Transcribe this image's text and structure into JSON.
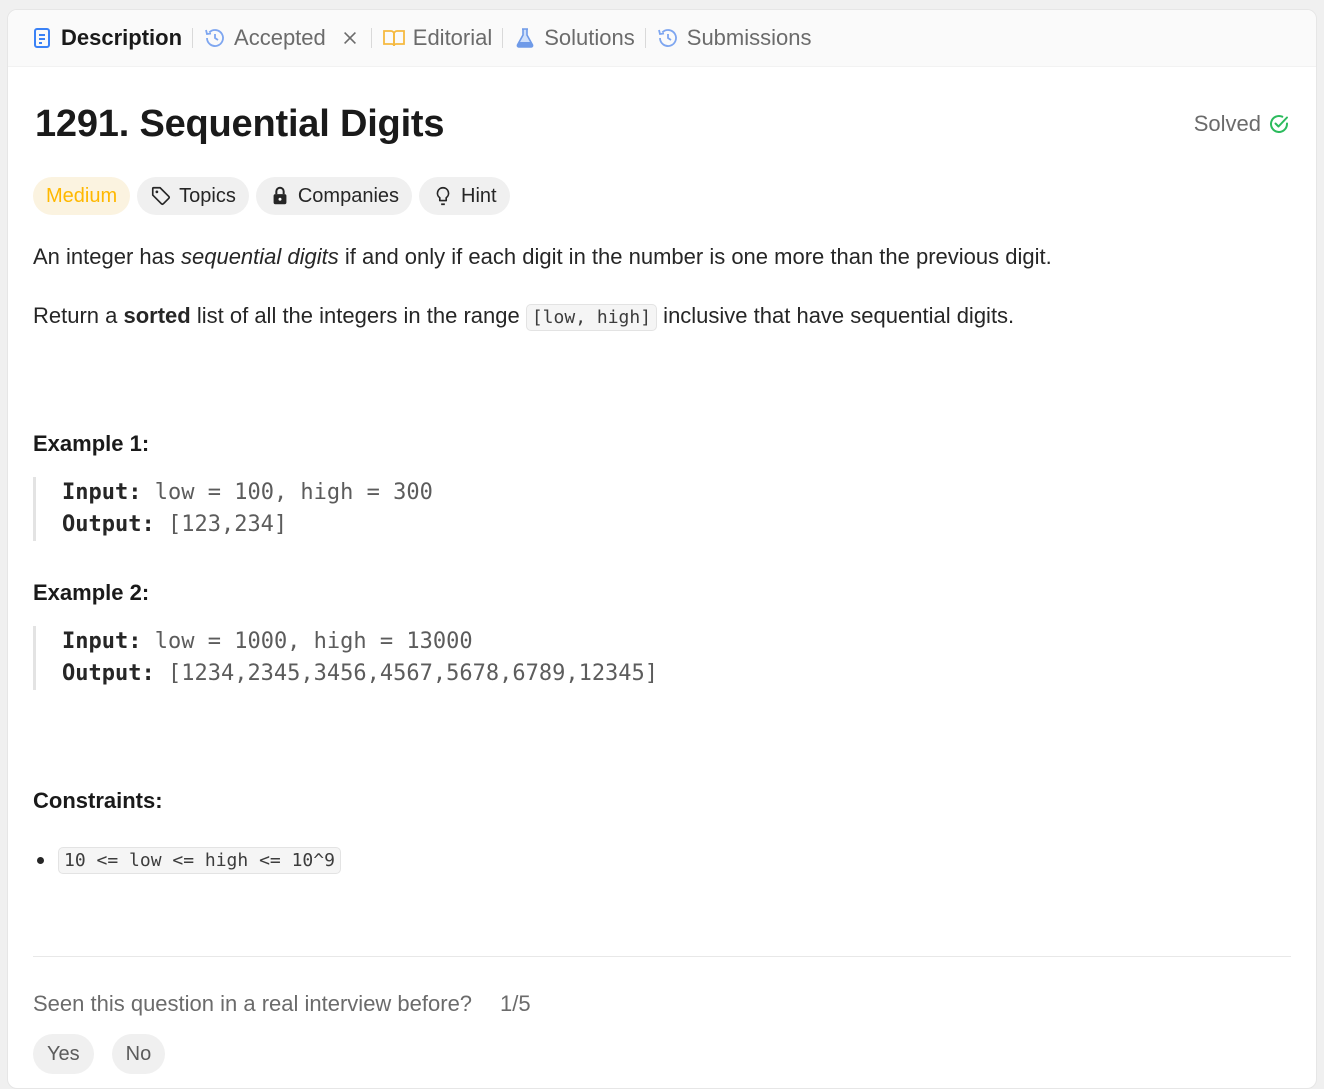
{
  "tabs": [
    {
      "label": "Description",
      "icon": "description-icon"
    },
    {
      "label": "Accepted",
      "icon": "history-icon"
    },
    {
      "label": "Editorial",
      "icon": "book-icon"
    },
    {
      "label": "Solutions",
      "icon": "flask-icon"
    },
    {
      "label": "Submissions",
      "icon": "history-icon"
    }
  ],
  "problem": {
    "title": "1291. Sequential Digits",
    "status": "Solved",
    "difficulty": "Medium",
    "chips": [
      "Topics",
      "Companies",
      "Hint"
    ],
    "statement": {
      "p1_a": "An integer has ",
      "p1_em": "sequential digits",
      "p1_b": " if and only if each digit in the number is one more than the previous digit.",
      "p2_a": "Return a ",
      "p2_b": "sorted",
      "p2_c": " list of all the integers in the range ",
      "p2_code": "[low, high]",
      "p2_d": " inclusive that have sequential digits."
    },
    "examples": [
      {
        "heading": "Example 1:",
        "input_label": "Input:",
        "input": "low = 100, high = 300",
        "output_label": "Output:",
        "output": "[123,234]"
      },
      {
        "heading": "Example 2:",
        "input_label": "Input:",
        "input": "low = 1000, high = 13000",
        "output_label": "Output:",
        "output": "[1234,2345,3456,4567,5678,6789,12345]"
      }
    ],
    "constraints_heading": "Constraints:",
    "constraints": [
      "10 <= low <= high <= 10^9"
    ]
  },
  "interview": {
    "question": "Seen this question in a real interview before?",
    "ratio": "1/5",
    "yes": "Yes",
    "no": "No"
  },
  "colors": {
    "accent_blue": "#3b82f6",
    "medium": "#ffb800",
    "solved_green": "#2cbb5d"
  }
}
